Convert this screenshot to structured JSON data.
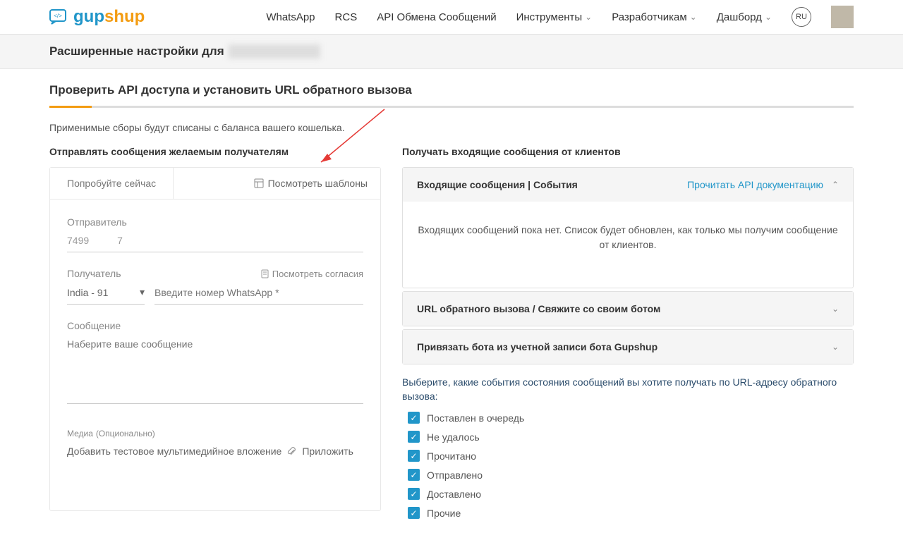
{
  "header": {
    "nav": [
      "WhatsApp",
      "RCS",
      "API Обмена Сообщений",
      "Инструменты",
      "Разработчикам",
      "Дашборд"
    ],
    "lang": "RU"
  },
  "subheader": {
    "prefix": "Расширенные настройки для"
  },
  "page": {
    "title": "Проверить API доступа и установить URL обратного вызова",
    "fees": "Применимые сборы будут списаны с баланса вашего кошелька."
  },
  "left": {
    "title": "Отправлять сообщения желаемым получателям",
    "tab": "Попробуйте сейчас",
    "view_templates": "Посмотреть шаблоны",
    "sender_label": "Отправитель",
    "sender_prefix": "7499",
    "sender_suffix": "7",
    "recipient_label": "Получатель",
    "view_consent": "Посмотреть согласия",
    "country": "India - 91",
    "phone_placeholder": "Введите номер WhatsApp *",
    "message_label": "Сообщение",
    "message_placeholder": "Наберите ваше сообщение",
    "media_label": "Медиа",
    "media_optional": "(Опционально)",
    "attach_text": "Добавить тестовое мультимедийное вложение",
    "attach_link": "Приложить"
  },
  "right": {
    "title": "Получать входящие сообщения от клиентов",
    "acc1_title": "Входящие сообщения | События",
    "acc1_link": "Прочитать API документацию",
    "acc1_body": "Входящих сообщений пока нет. Список будет обновлен, как только мы получим сообщение от клиентов.",
    "acc2_title": "URL обратного вызова / Свяжите со своим ботом",
    "acc3_title": "Привязать бота из учетной записи бота Gupshup",
    "events_text": "Выберите, какие события состояния сообщений вы хотите получать по URL-адресу обратного вызова:",
    "checks": [
      "Поставлен в очередь",
      "Не удалось",
      "Прочитано",
      "Отправлено",
      "Доставлено",
      "Прочие"
    ]
  }
}
